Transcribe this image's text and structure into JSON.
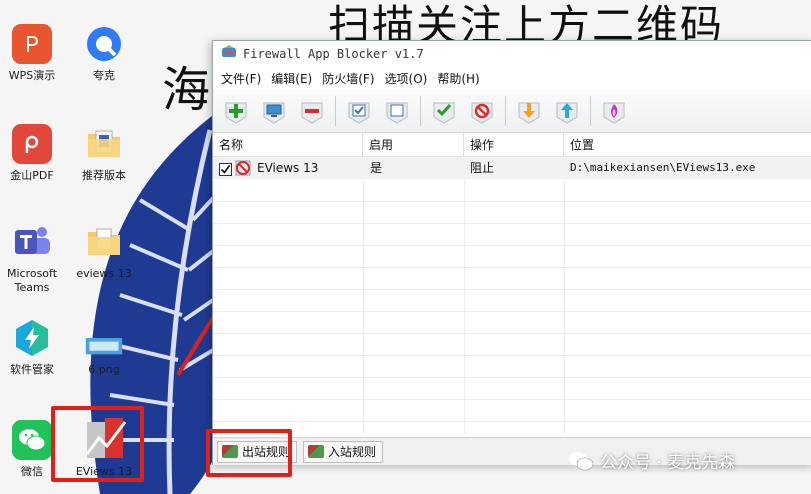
{
  "background": {
    "title_text": "扫描关注上方二维码",
    "side_text": "海"
  },
  "desktop_icons": [
    {
      "label": "WPS演示",
      "icon": "wps-presentation-icon"
    },
    {
      "label": "夸克",
      "icon": "quark-browser-icon"
    },
    {
      "label": "金山PDF",
      "icon": "kingsoft-pdf-icon"
    },
    {
      "label": "推荐版本",
      "icon": "folder-icon"
    },
    {
      "label": "Microsoft Teams",
      "icon": "microsoft-teams-icon"
    },
    {
      "label": "eviews 13",
      "icon": "folder-icon"
    },
    {
      "label": "软件管家",
      "icon": "software-manager-icon"
    },
    {
      "label": "6.png",
      "icon": "image-file-icon"
    },
    {
      "label": "微信",
      "icon": "wechat-icon"
    },
    {
      "label": "EViews 13",
      "icon": "eviews-icon"
    }
  ],
  "window": {
    "title": "Firewall App Blocker v1.7",
    "menu": [
      "文件(F)",
      "编辑(E)",
      "防火墙(F)",
      "选项(O)",
      "帮助(H)"
    ],
    "toolbar": [
      "add-icon",
      "monitor-icon",
      "remove-icon",
      "check-all-icon",
      "uncheck-all-icon",
      "allow-icon",
      "block-icon",
      "move-down-icon",
      "move-up-icon",
      "firewall-shield-icon"
    ],
    "columns": [
      "名称",
      "启用",
      "操作",
      "位置"
    ],
    "rows": [
      {
        "checked": true,
        "name": "EViews 13",
        "enabled": "是",
        "action": "阻止",
        "location": "D:\\maikexiansen\\EViews13.exe"
      }
    ],
    "tabs": [
      "出站规则",
      "入站规则"
    ]
  },
  "watermark": {
    "text": "公众号 · 麦克先森"
  },
  "colors": {
    "highlight_red": "#e0211a",
    "leaf_blue": "#1f3a93"
  }
}
